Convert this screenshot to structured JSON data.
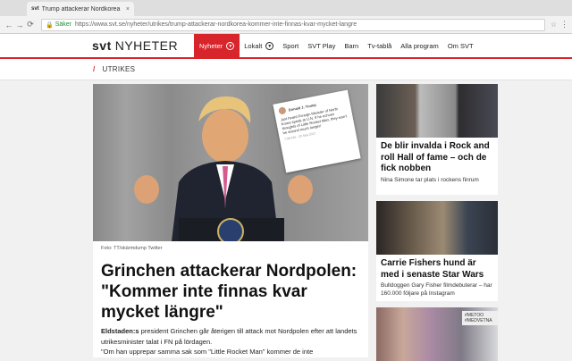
{
  "browser": {
    "tab_title": "Trump attackerar Nordkorea",
    "tab_favicon": "svt",
    "tab_close": "×",
    "secure_label": "Säker",
    "url": "https://www.svt.se/nyheter/utrikes/trump-attackerar-nordkorea-kommer-inte-finnas-kvar-mycket-langre"
  },
  "header": {
    "logo_brand": "svt",
    "logo_section": "NYHETER",
    "nav": [
      {
        "label": "Nyheter"
      },
      {
        "label": "Lokalt"
      },
      {
        "label": "Sport"
      },
      {
        "label": "SVT Play"
      },
      {
        "label": "Barn"
      },
      {
        "label": "Tv-tablå"
      },
      {
        "label": "Alla program"
      },
      {
        "label": "Om SVT"
      }
    ]
  },
  "section": {
    "label": "UTRIKES"
  },
  "article": {
    "photo_credit": "Foto: TT/skärmdump Twitter",
    "headline": "Grinchen attackerar Nordpolen: \"Kommer inte finnas kvar mycket längre\"",
    "lead_dateline": "Eldstaden:s",
    "lead_text": " president Grinchen går återigen till attack mot Nordpolen efter att landets utrikesminister talat i FN på lördagen.",
    "lead_quote": "\"Om han upprepar samma sak som \"Little Rocket Man\" kommer de inte",
    "tweet": {
      "name": "Donald J. Trump",
      "text": "Just heard Foreign Minister of North Korea speak at U.N. If he echoes thoughts of Little Rocket Man, they won't be around much longer!",
      "time": "7:08 PM - 23 Sep 2017"
    }
  },
  "sidebar": [
    {
      "title": "De blir invalda i Rock and roll Hall of fame – och de fick nobben",
      "sub": "Nina Simone tar plats i rockens finrum"
    },
    {
      "title": "Carrie Fishers hund är med i senaste Star Wars",
      "sub": "Bulldoggen Gary Fisher filmdebuterar – har 160.000 följare på Instagram"
    },
    {
      "tag": "#METOO #MEDVETNA"
    }
  ],
  "colors": {
    "brand_red": "#d8242b"
  }
}
